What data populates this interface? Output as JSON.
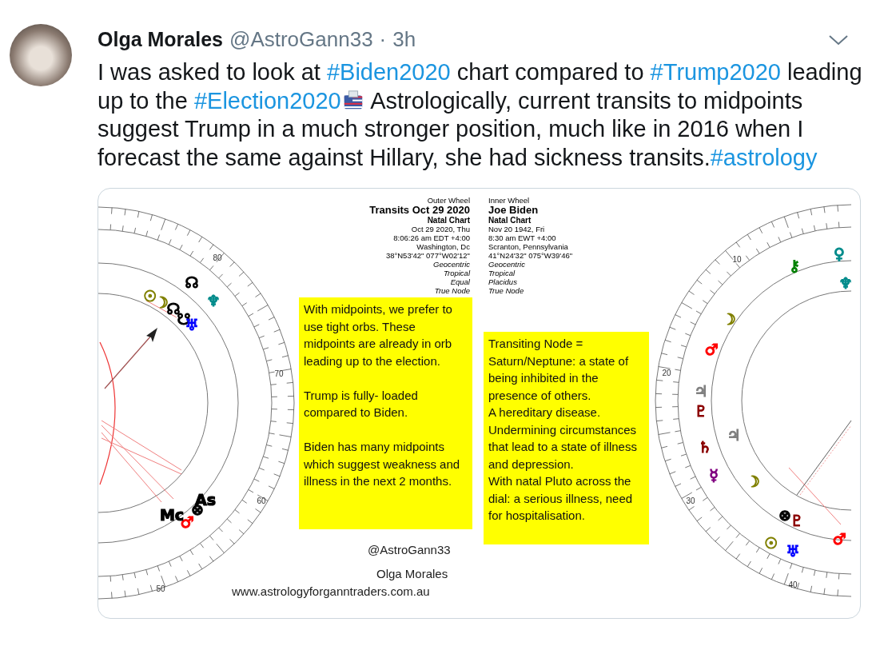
{
  "tweet": {
    "author_name": "Olga Morales",
    "handle": "@AstroGann33",
    "separator": "·",
    "time": "3h",
    "text": [
      {
        "kind": "text",
        "text": "I was asked to look at "
      },
      {
        "kind": "hashtag",
        "text": "#Biden2020"
      },
      {
        "kind": "text",
        "text": " chart compared to "
      },
      {
        "kind": "hashtag",
        "text": "#Trump2020"
      },
      {
        "kind": "text",
        "text": " leading up to the "
      },
      {
        "kind": "hashtag",
        "text": "#Election2020"
      },
      {
        "kind": "emoji"
      },
      {
        "kind": "text",
        "text": " Astrologically, current transits to midpoints suggest Trump in a much stronger position, much like in 2016 when I forecast the same against Hillary, she had sickness transits."
      },
      {
        "kind": "hashtag",
        "text": "#astrology"
      }
    ]
  },
  "image": {
    "outer_wheel": {
      "caption": "Outer Wheel",
      "title": "Transits Oct 29 2020",
      "subtitle": "Natal Chart",
      "details": [
        "Oct 29 2020, Thu",
        "8:06:26 am  EDT +4:00",
        "Washington, Dc",
        "38°N53'42\" 077°W02'12\""
      ],
      "settings": [
        "Geocentric",
        "Tropical",
        "Equal",
        "True Node"
      ]
    },
    "inner_wheel": {
      "caption": "Inner Wheel",
      "title": "Joe Biden",
      "subtitle": "Natal Chart",
      "details": [
        "Nov 20 1942, Fri",
        "8:30 am  EWT +4:00",
        "Scranton, Pennsylvania",
        "41°N24'32\" 075°W39'46\""
      ],
      "settings": [
        "Geocentric",
        "Tropical",
        "Placidus",
        "True Node"
      ]
    },
    "notes": [
      {
        "paragraphs": [
          "With midpoints, we prefer to use tight orbs. These midpoints are already in orb leading up to the election.",
          "Trump is fully- loaded compared to Biden.",
          "Biden has many midpoints which suggest weakness and illness in the next 2 months."
        ]
      },
      {
        "lines": [
          "Transiting Node = Saturn/Neptune: a state of being inhibited in the presence of others.",
          "A hereditary disease.",
          "Undermining circumstances that lead to a state of illness and depression.",
          "With natal Pluto across the dial: a serious illness, need for hospitalisation."
        ]
      }
    ],
    "credits": [
      "@AstroGann33",
      "Olga Morales",
      "www.astrologyforganntraders.com.au"
    ],
    "wheels": [
      {
        "degree_labels": [
          "80",
          "70",
          "60",
          "50"
        ],
        "glyphs": [
          {
            "symbol": "☊",
            "color": "#000000"
          },
          {
            "symbol": "♆",
            "color": "#008b8b"
          },
          {
            "symbol": "☉",
            "color": "#808000"
          },
          {
            "symbol": "☽",
            "color": "#808000"
          },
          {
            "symbol": "☊",
            "color": "#000000"
          },
          {
            "symbol": "☋",
            "color": "#000000"
          },
          {
            "symbol": "♅",
            "color": "#0000ff"
          },
          {
            "symbol": "As",
            "color": "#000000"
          },
          {
            "symbol": "⊗",
            "color": "#000000"
          },
          {
            "symbol": "♂",
            "color": "#ff0000"
          },
          {
            "symbol": "Mc",
            "color": "#000000"
          }
        ]
      },
      {
        "degree_labels": [
          "10",
          "20",
          "30",
          "40"
        ],
        "glyphs": [
          {
            "symbol": "⚷",
            "color": "#008000"
          },
          {
            "symbol": "♀",
            "color": "#008b8b"
          },
          {
            "symbol": "♆",
            "color": "#008b8b"
          },
          {
            "symbol": "☽",
            "color": "#808000"
          },
          {
            "symbol": "♂",
            "color": "#ff0000"
          },
          {
            "symbol": "♃",
            "color": "#808080"
          },
          {
            "symbol": "♇",
            "color": "#8b0000"
          },
          {
            "symbol": "♃",
            "color": "#808080"
          },
          {
            "symbol": "♄",
            "color": "#8b0000"
          },
          {
            "symbol": "☿",
            "color": "#800080"
          },
          {
            "symbol": "☽",
            "color": "#808000"
          },
          {
            "symbol": "⊗",
            "color": "#000000"
          },
          {
            "symbol": "♇",
            "color": "#8b0000"
          },
          {
            "symbol": "♂",
            "color": "#ff0000"
          },
          {
            "symbol": "☉",
            "color": "#808000"
          },
          {
            "symbol": "♅",
            "color": "#0000ff"
          }
        ]
      }
    ]
  }
}
